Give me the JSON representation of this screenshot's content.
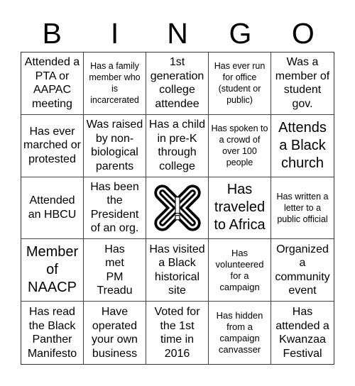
{
  "header": {
    "letters": [
      "B",
      "I",
      "N",
      "G",
      "O"
    ]
  },
  "free_space": {
    "icon": "interlocking-knot-icon"
  },
  "cells": [
    "Attended a PTA or AAPAC meeting",
    "Has a family member who is incarcerated",
    "1st generation college attendee",
    "Has ever run for office (student or public)",
    "Was a member of student gov.",
    "Has ever marched or protested",
    "Was raised by non-biological parents",
    "Has a child in pre-K through college",
    "Has spoken to a crowd of over 100 people",
    "Attends a Black church",
    "Attended an HBCU",
    "Has been the President of an org.",
    "",
    "Has traveled to Africa",
    "Has written a letter to a public official",
    "Member of NAACP",
    "Has met PM Treadu",
    "Has visited a Black historical site",
    "Has volunteered for a campaign",
    "Organized a community event",
    "Has read the Black Panther Manifesto",
    "Have operated your own business",
    "Voted for the 1st time in 2016",
    "Has hidden from a campaign canvasser",
    "Has attended a Kwanzaa Festival"
  ]
}
